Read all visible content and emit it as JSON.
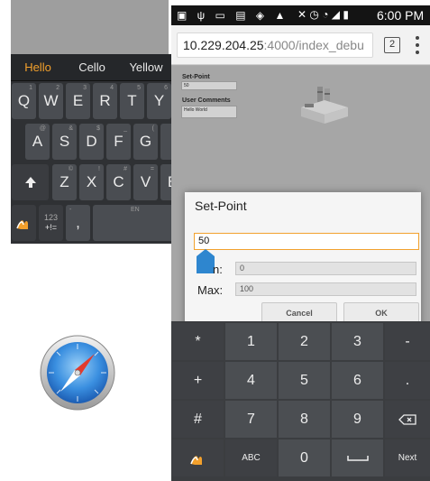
{
  "left_keyboard": {
    "suggestions": [
      "Hello",
      "Cello",
      "Yellow"
    ],
    "row1": [
      {
        "label": "Q",
        "hint": "1"
      },
      {
        "label": "W",
        "hint": "2"
      },
      {
        "label": "E",
        "hint": "3"
      },
      {
        "label": "R",
        "hint": "4"
      },
      {
        "label": "T",
        "hint": "5"
      },
      {
        "label": "Y",
        "hint": "6"
      }
    ],
    "row2": [
      {
        "label": "A",
        "hint": "@"
      },
      {
        "label": "S",
        "hint": "&"
      },
      {
        "label": "D",
        "hint": "$"
      },
      {
        "label": "F",
        "hint": "_"
      },
      {
        "label": "G",
        "hint": "("
      }
    ],
    "row3": [
      {
        "label": "Z",
        "hint": "©"
      },
      {
        "label": "X",
        "hint": "!"
      },
      {
        "label": "C",
        "hint": "#"
      },
      {
        "label": "V",
        "hint": "="
      },
      {
        "label": "B",
        "hint": ""
      }
    ],
    "bottom": {
      "nums_label": "123",
      "sym_label": "+!=",
      "comma": ",",
      "dash_hint": "-",
      "space_label": "EN"
    }
  },
  "phone": {
    "status": {
      "icons": "▣ ψ ▭ ▤ ◈ ▲",
      "right_icons": "✕ ◷ ◔ ◢ ▮",
      "time": "6:00 PM"
    },
    "browser": {
      "url_host": "10.229.204.25",
      "url_path": ":4000/index_debu",
      "tab_count": "2"
    },
    "page": {
      "setpoint_label": "Set-Point",
      "setpoint_value": "50",
      "comments_label": "User Comments",
      "comments_value": "Hello World"
    },
    "dialog": {
      "title": "Set-Point",
      "input_value": "50",
      "min_label": "n:",
      "min_value": "0",
      "max_label": "Max:",
      "max_value": "100",
      "cancel_label": "Cancel",
      "ok_label": "OK"
    },
    "numpad": {
      "rows": [
        [
          "*",
          "1",
          "2",
          "3",
          "-"
        ],
        [
          "+",
          "4",
          "5",
          "6",
          "."
        ],
        [
          "#",
          "7",
          "8",
          "9",
          "⌫"
        ],
        [
          "",
          "ABC",
          "0",
          "␣",
          "Next"
        ]
      ]
    }
  },
  "colors": {
    "accent": "#f3a02c",
    "dialog_border": "#f2a22e",
    "cursor_blue": "#2e86cf"
  }
}
